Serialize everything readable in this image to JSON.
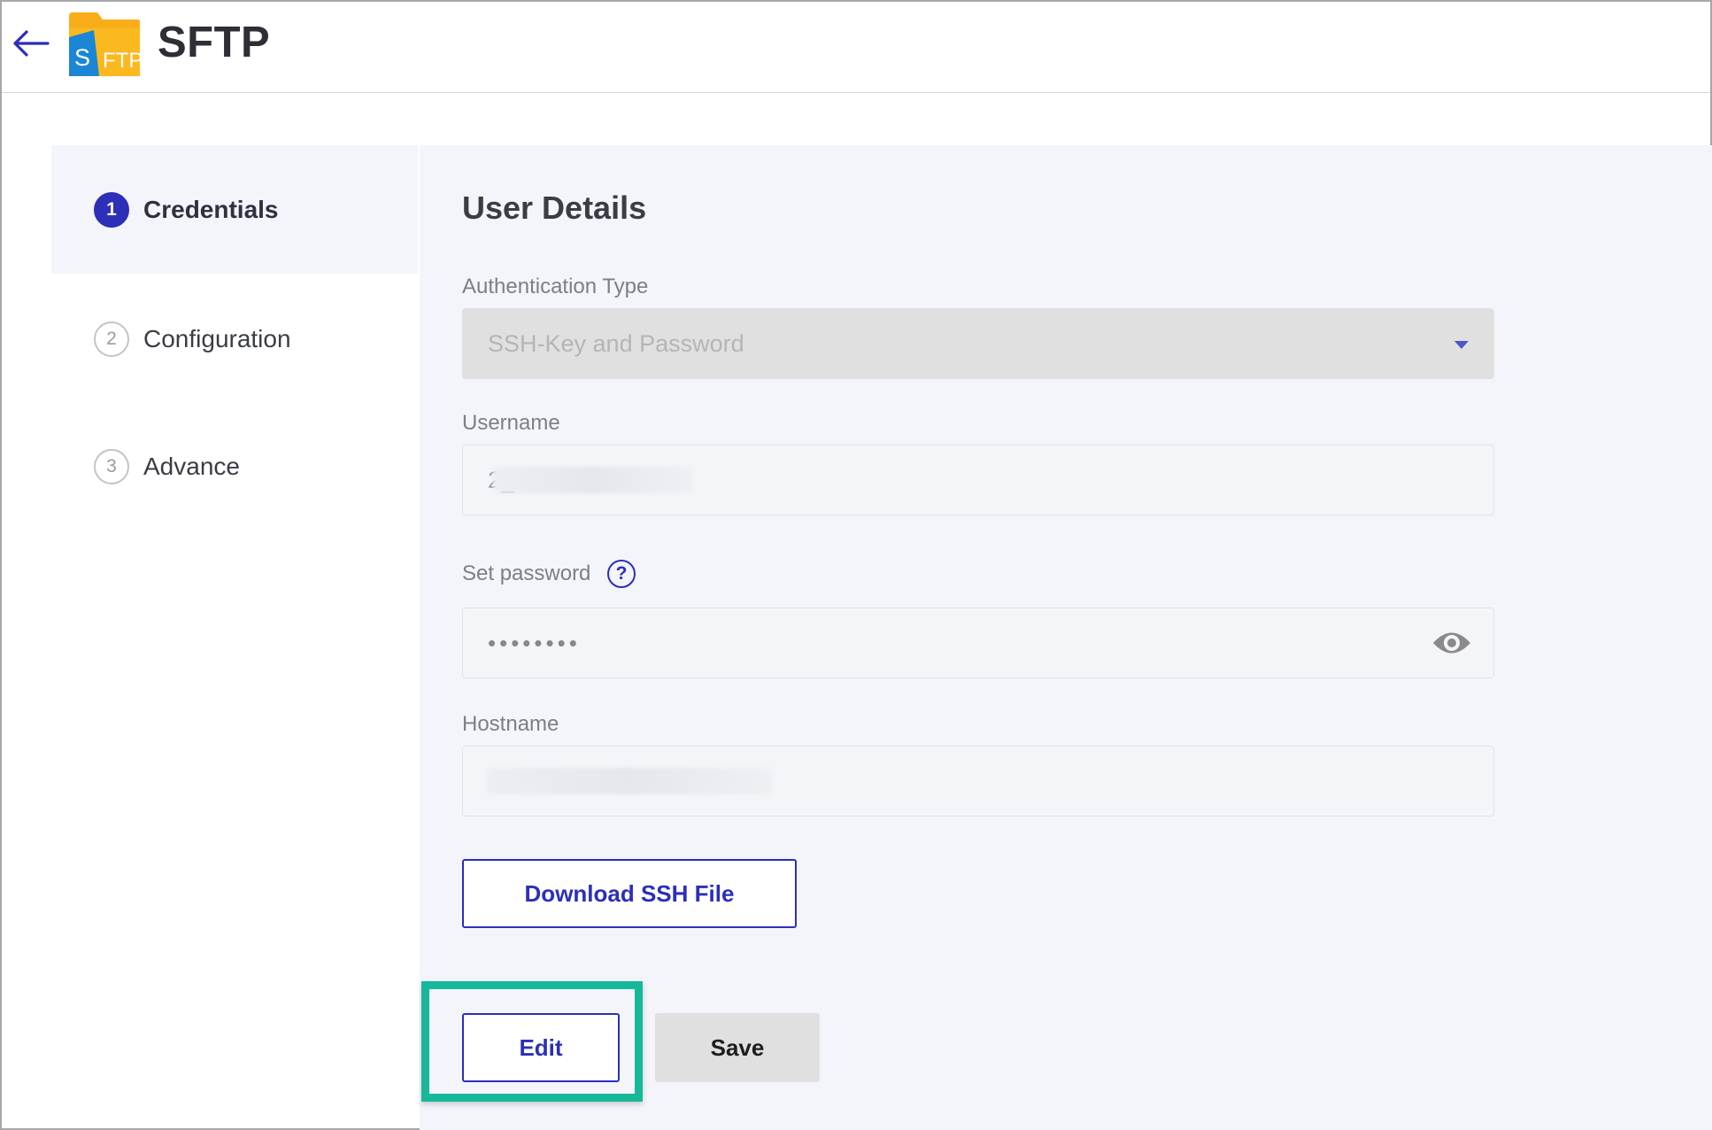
{
  "header": {
    "title": "SFTP",
    "logo_text": "S FTP"
  },
  "steps": [
    {
      "number": "1",
      "label": "Credentials",
      "active": true
    },
    {
      "number": "2",
      "label": "Configuration",
      "active": false
    },
    {
      "number": "3",
      "label": "Advance",
      "active": false
    }
  ],
  "form": {
    "section_title": "User Details",
    "auth_type": {
      "label": "Authentication Type",
      "value": "SSH-Key and Password"
    },
    "username": {
      "label": "Username",
      "value": "2_"
    },
    "password": {
      "label": "Set password",
      "help": "?",
      "value": "••••••••"
    },
    "hostname": {
      "label": "Hostname",
      "value": ""
    },
    "download_button": "Download SSH File"
  },
  "actions": {
    "edit": "Edit",
    "save": "Save"
  },
  "colors": {
    "accent": "#2c2fb8",
    "highlight": "#17b79a",
    "panel": "#f3f5fb"
  },
  "icons": {
    "back": "arrow-left-icon",
    "logo": "sftp-folder-icon",
    "help": "question-circle-icon",
    "eye": "eye-icon",
    "caret": "chevron-down-icon"
  }
}
